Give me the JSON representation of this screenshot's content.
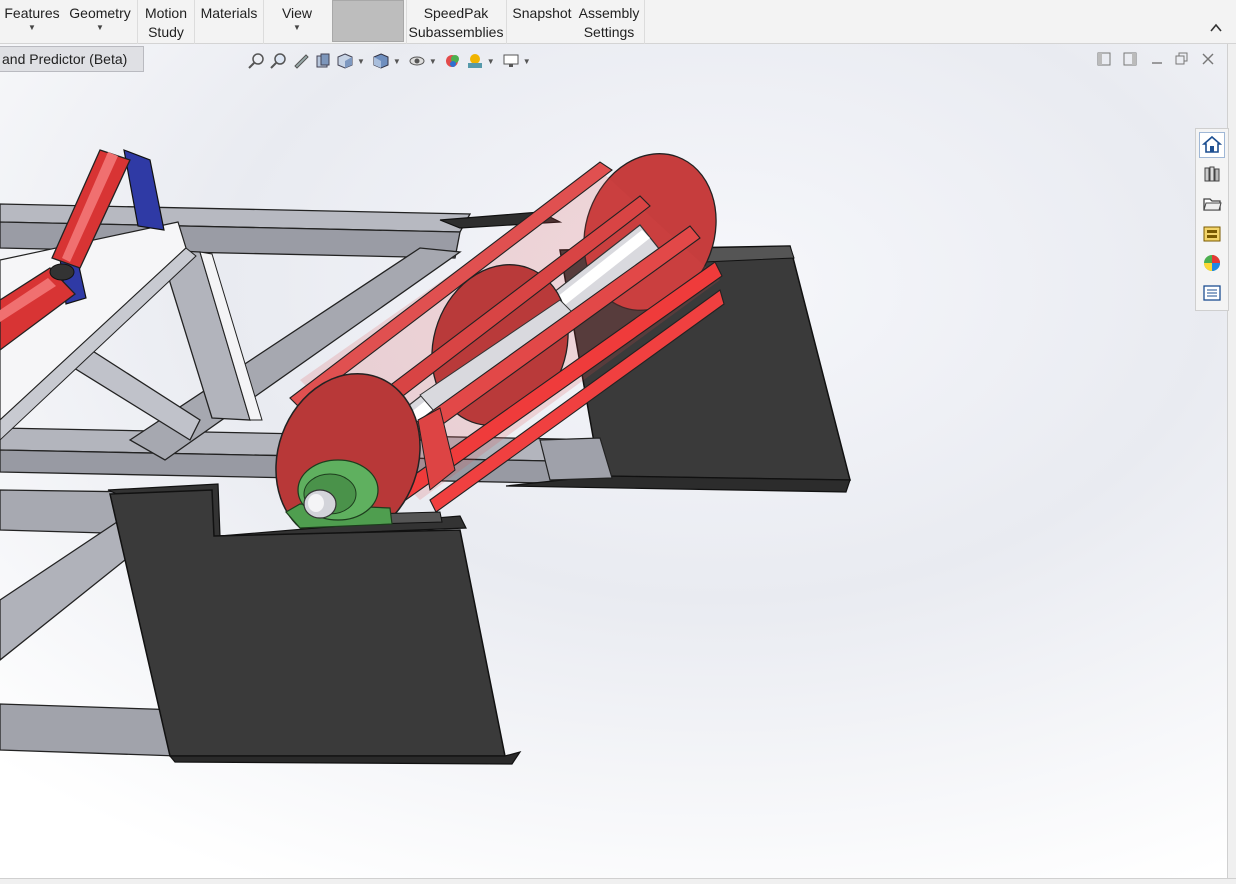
{
  "ribbon": {
    "items": [
      {
        "label1": "Features",
        "label2": "",
        "caret": true
      },
      {
        "label1": "Geometry",
        "label2": "",
        "caret": true
      },
      {
        "label1": "Motion",
        "label2": "Study",
        "caret": false
      },
      {
        "label1": "Materials",
        "label2": "",
        "caret": false
      },
      {
        "label1": "View",
        "label2": "",
        "caret": true
      },
      {
        "label1": "SpeedPak",
        "label2": "Subassemblies",
        "caret": false
      },
      {
        "label1": "Snapshot",
        "label2": "",
        "caret": false
      },
      {
        "label1": "Assembly",
        "label2": "Settings",
        "caret": false
      }
    ],
    "collapse_icon": "chevron-up-icon"
  },
  "tab": {
    "label": "and Predictor (Beta)"
  },
  "heads_up_toolbar": [
    "zoom-to-fit-icon",
    "zoom-to-area-icon",
    "previous-view-icon",
    "section-view-icon",
    "view-orientation-icon",
    "display-style-icon",
    "hide-show-items-icon",
    "edit-appearance-icon",
    "apply-scene-icon",
    "view-settings-icon"
  ],
  "window_controls": [
    "tile-left-icon",
    "tile-right-icon",
    "minimize-icon",
    "restore-icon",
    "close-icon"
  ],
  "task_pane": [
    {
      "icon": "home-icon",
      "active": true
    },
    {
      "icon": "design-library-icon",
      "active": false
    },
    {
      "icon": "file-explorer-icon",
      "active": false
    },
    {
      "icon": "view-palette-icon",
      "active": false
    },
    {
      "icon": "appearances-icon",
      "active": false
    },
    {
      "icon": "custom-properties-icon",
      "active": false
    }
  ],
  "colors": {
    "frame": "#a9abb3",
    "roller": "#d83434",
    "drum": "#c63d3d",
    "plate": "#3a3a3a",
    "bearing": "#5fb05f",
    "bracket": "#2f3aa5"
  }
}
